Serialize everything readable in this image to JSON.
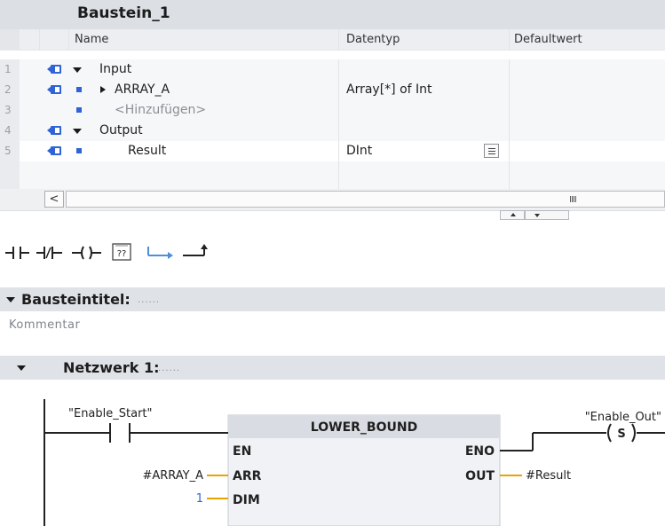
{
  "block": {
    "title": "Baustein_1"
  },
  "table": {
    "headers": {
      "name": "Name",
      "datatype": "Datentyp",
      "default": "Defaultwert"
    },
    "rows": [
      {
        "num": "1",
        "name": "Input",
        "datatype": ""
      },
      {
        "num": "2",
        "name": "ARRAY_A",
        "datatype": "Array[*] of Int"
      },
      {
        "num": "3",
        "name": "<Hinzufügen>",
        "datatype": ""
      },
      {
        "num": "4",
        "name": "Output",
        "datatype": ""
      },
      {
        "num": "5",
        "name": "Result",
        "datatype": "DInt"
      }
    ]
  },
  "scrollbar": {
    "left_arrow": "<",
    "grip": "IIII"
  },
  "toolbar": {
    "tools": [
      {
        "icon": "no-contact-icon"
      },
      {
        "icon": "nc-contact-icon"
      },
      {
        "icon": "coil-icon"
      },
      {
        "icon": "empty-box-icon",
        "label": "??"
      },
      {
        "icon": "branch-open-icon"
      },
      {
        "icon": "branch-close-icon"
      }
    ]
  },
  "block_title_section": {
    "label": "Bausteintitel:",
    "dots": "......",
    "comment": "Kommentar"
  },
  "network": {
    "label": "Netzwerk 1:",
    "dots": "......",
    "contact_tag": "\"Enable_Start\"",
    "coil_tag": "\"Enable_Out\"",
    "coil_symbol": "S",
    "box": {
      "title": "LOWER_BOUND",
      "in_en": "EN",
      "in_arr": "ARR",
      "in_dim": "DIM",
      "out_eno": "ENO",
      "out_out": "OUT"
    },
    "arr_param": "#ARRAY_A",
    "dim_param": "1",
    "out_param": "#Result"
  },
  "colors": {
    "accent_blue": "#2f63d6",
    "wire_green": "#3ca03c",
    "param_yellow": "#e8a400",
    "box_header": "#d9dde3"
  }
}
